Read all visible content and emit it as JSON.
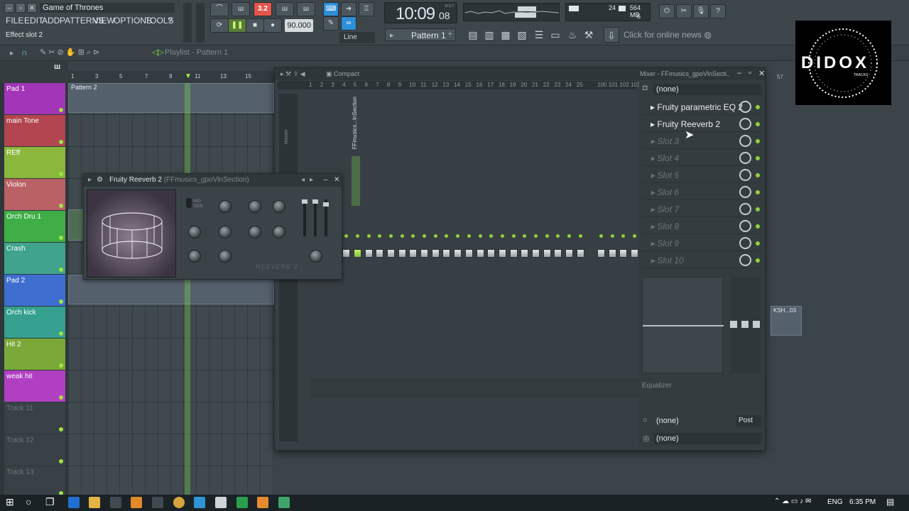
{
  "app": {
    "project_title": "Game of Thrones",
    "hint": "Effect slot 2",
    "menu": [
      "FILE",
      "EDIT",
      "ADD",
      "PATTERNS",
      "VIEW",
      "OPTIONS",
      "TOOLS",
      "?"
    ]
  },
  "transport": {
    "pattern_song": "3.2",
    "tempo": "90.000",
    "time_main": "10:09",
    "time_sub": "08",
    "time_unit": "B:S:T",
    "pattern_name": "Pattern 1",
    "snap": "Line",
    "cpu": "24",
    "mem": "564 MB",
    "polyphony": "6",
    "news": "Click for online news"
  },
  "playlist": {
    "title": "Playlist - Pattern 1",
    "ruler": [
      "1",
      "3",
      "5",
      "7",
      "9",
      "11",
      "13",
      "15"
    ],
    "clip_label": "Pattern 2",
    "tracks": [
      {
        "name": "Pad 1",
        "color": "#a235b8"
      },
      {
        "name": "main Tone",
        "color": "#b2454f"
      },
      {
        "name": "REff",
        "color": "#8bb83c"
      },
      {
        "name": "Violon",
        "color": "#ba6166"
      },
      {
        "name": "Orch Dru 1",
        "color": "#3fae47"
      },
      {
        "name": "Crash",
        "color": "#3fa38d"
      },
      {
        "name": "Pad 2",
        "color": "#3e6fd0"
      },
      {
        "name": "Orch kick",
        "color": "#35a08f"
      },
      {
        "name": "Hit 2",
        "color": "#7aa838"
      },
      {
        "name": "weak hit",
        "color": "#b03fc2"
      },
      {
        "name": "Track 11",
        "color": "#3b4347"
      },
      {
        "name": "Track 12",
        "color": "#3b4347"
      },
      {
        "name": "Track 13",
        "color": "#3b4347"
      }
    ]
  },
  "reverb": {
    "title": "Fruity Reeverb 2",
    "subtitle": "(FFmusics_gpoVlnSection)",
    "brand": "REEVERB 2",
    "switch": "MID SIDE",
    "knob_labels": [
      "SIZE",
      "DIFF",
      "DEC",
      "DAMP",
      "HICUT",
      "LOCUT",
      "DELAY",
      "COLOR",
      "SEP",
      "DRY",
      "ER",
      "WET"
    ]
  },
  "mixer": {
    "title": "Mixer - FFmusics_gpoVlnSecti..",
    "view_mode": "Compact",
    "numbers": [
      "1",
      "2",
      "3",
      "4",
      "5",
      "6",
      "7",
      "8",
      "9",
      "10",
      "11",
      "12",
      "13",
      "14",
      "15",
      "16",
      "17",
      "18",
      "19",
      "20",
      "21",
      "22",
      "23",
      "24",
      "25",
      "100",
      "101",
      "102",
      "103"
    ],
    "master_label": "Master",
    "selected_insert": "FFmusics...lnSection",
    "input": "(none)",
    "slots": [
      "Fruity parametric EQ 2",
      "Fruity Reeverb 2",
      "Slot 3",
      "Slot 4",
      "Slot 5",
      "Slot 6",
      "Slot 7",
      "Slot 8",
      "Slot 9",
      "Slot 10"
    ],
    "eq_label": "Equalizer",
    "out_label": "(none)",
    "post": "Post",
    "out2": "(none)",
    "right_clip": "KSH...03",
    "right_ruler": "57"
  },
  "taskbar": {
    "lang": "ENG",
    "time": "6:35 PM"
  },
  "logo": {
    "text": "DIDOX",
    "sub": "TRACKS"
  }
}
